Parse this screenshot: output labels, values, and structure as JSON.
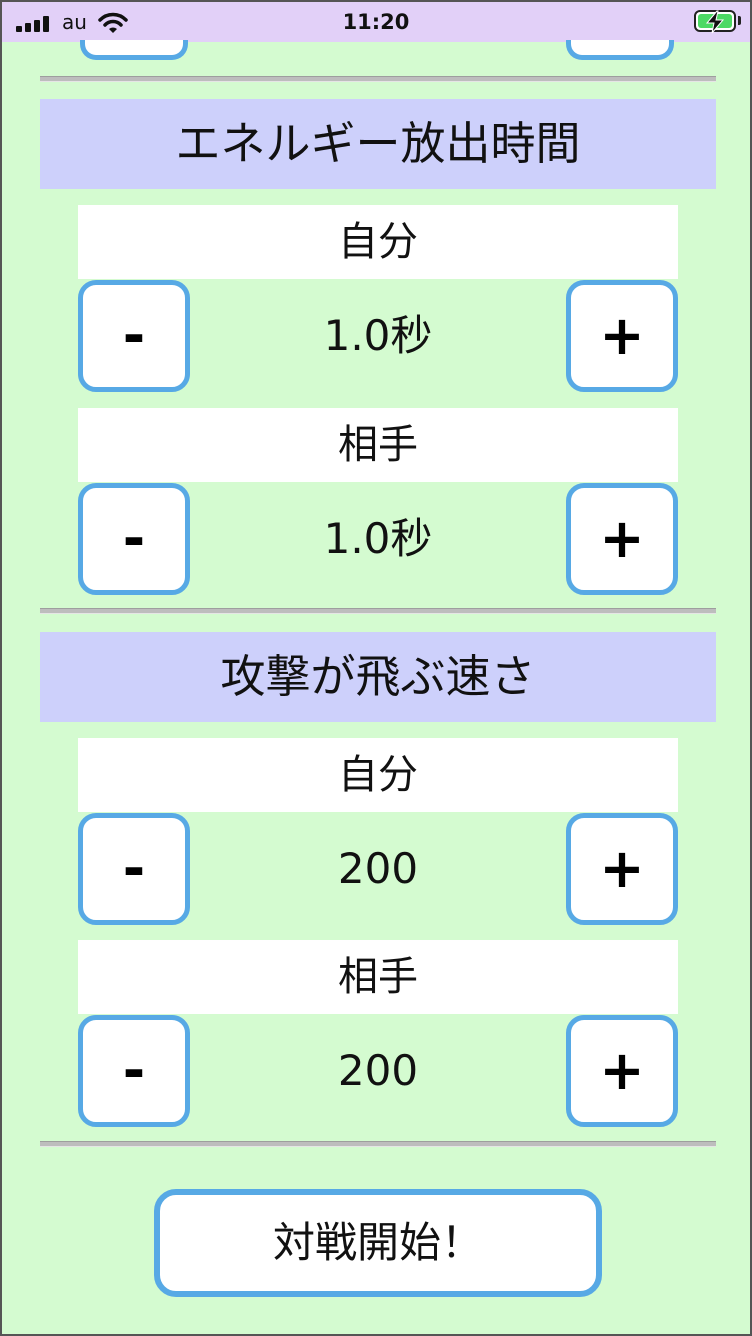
{
  "status_bar": {
    "carrier": "au",
    "time": "11:20"
  },
  "sections": [
    {
      "title": "エネルギー放出時間",
      "rows": [
        {
          "label": "自分",
          "value": "1.0秒"
        },
        {
          "label": "相手",
          "value": "1.0秒"
        }
      ]
    },
    {
      "title": "攻撃が飛ぶ速さ",
      "rows": [
        {
          "label": "自分",
          "value": "200"
        },
        {
          "label": "相手",
          "value": "200"
        }
      ]
    }
  ],
  "controls": {
    "minus": "-",
    "plus": "+"
  },
  "start_button": "対戦開始！",
  "colors": {
    "background": "#d4fbd0",
    "status_bar": "#e2d0f8",
    "section_header": "#cdd0fb",
    "button_border": "#57a9e5",
    "battery": "#4cd964"
  }
}
